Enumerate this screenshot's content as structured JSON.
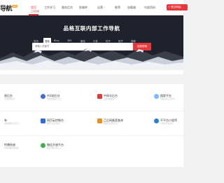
{
  "nav": {
    "logo": "导航",
    "logo_tag": "PRO",
    "items": [
      {
        "label": "首页",
        "sub": "工具导航"
      },
      {
        "label": "工作学习"
      },
      {
        "label": "服务后台"
      },
      {
        "label": "前端库"
      },
      {
        "label": "运营"
      },
      {
        "label": "推荐"
      },
      {
        "label": "加载器"
      },
      {
        "label": "内部资料"
      }
    ],
    "submit_label": "+ 提交网站"
  },
  "hero": {
    "title": "品格互联内部工作导航",
    "tabs": [
      "常用",
      "搜索",
      "Blog",
      "360",
      "微信",
      "头条",
      "知乎",
      "知乎",
      "视频"
    ],
    "search_placeholder": "请输入关键字",
    "search_button": "百度搜索"
  },
  "sections": [
    {
      "rows": [
        [
          {
            "name": "直后台",
            "desc": "平台管理后台",
            "color": "#3b82f6"
          },
          {
            "name": "中2网后台",
            "desc": "内部管理后台入口",
            "color": "#3b6fd1"
          },
          {
            "name": "中网号后台",
            "desc": "后台内容管理",
            "color": "#e5383b"
          },
          {
            "name": "搜索平台",
            "desc": "搜索优化工具平台",
            "color": "#7db7ff"
          }
        ],
        [
          {
            "name": "有",
            "desc": "内容管理平台工具",
            "color": "#8ec5ff"
          },
          {
            "name": "网页云控制台",
            "desc": "网页云后台管理",
            "color": "#2f6bd8"
          },
          {
            "name": "乙后网备案查询",
            "desc": "备案信息查询工具",
            "color": "#f08c1a"
          },
          {
            "name": "平平台小程序",
            "desc": "小程序开发平台",
            "color": "#2a7fd6"
          }
        ],
        [
          {
            "name": "传播系统",
            "desc": "内部传播管理系统",
            "color": "#5aa0e6"
          },
          {
            "name": "微信开放平台",
            "desc": "微信开放平台入口",
            "color": "#3fb24a"
          }
        ]
      ]
    }
  ]
}
